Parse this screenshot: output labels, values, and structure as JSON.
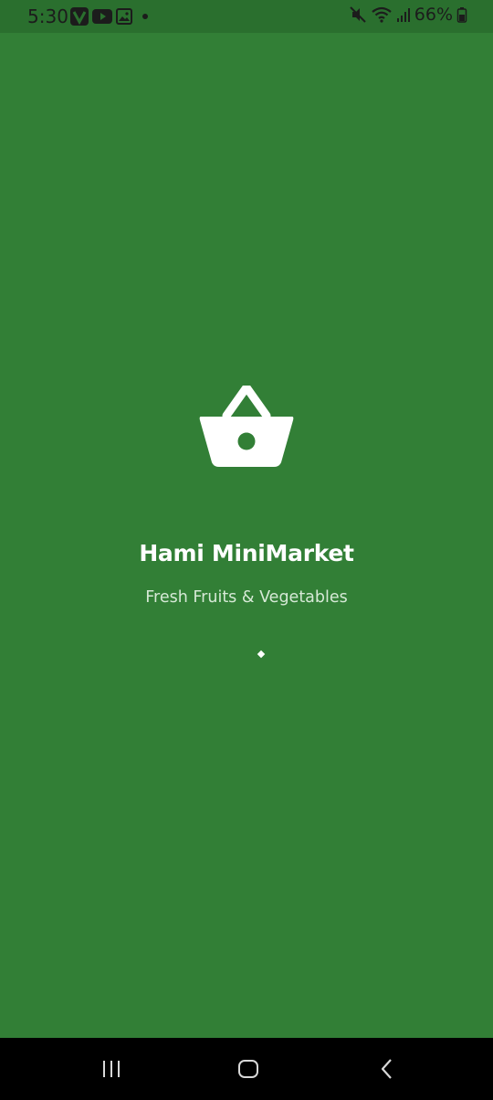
{
  "status_bar": {
    "time": "5:30",
    "battery": "66%",
    "left_icons": [
      "vibe-app-icon",
      "youtube-icon",
      "gallery-icon",
      "dot-icon"
    ],
    "right_icons": [
      "mute-icon",
      "wifi-icon",
      "signal-icon",
      "battery-icon"
    ]
  },
  "splash": {
    "title": "Hami MiniMarket",
    "subtitle": "Fresh Fruits & Vegetables",
    "icon": "basket-icon"
  },
  "colors": {
    "background": "#327f36",
    "status_bar": "#2a6f2e",
    "title": "#ffffff",
    "subtitle": "#d6e9d6",
    "nav_bar": "#000000"
  },
  "nav_bar": {
    "buttons": [
      "recent-apps-icon",
      "home-icon",
      "back-icon"
    ]
  }
}
